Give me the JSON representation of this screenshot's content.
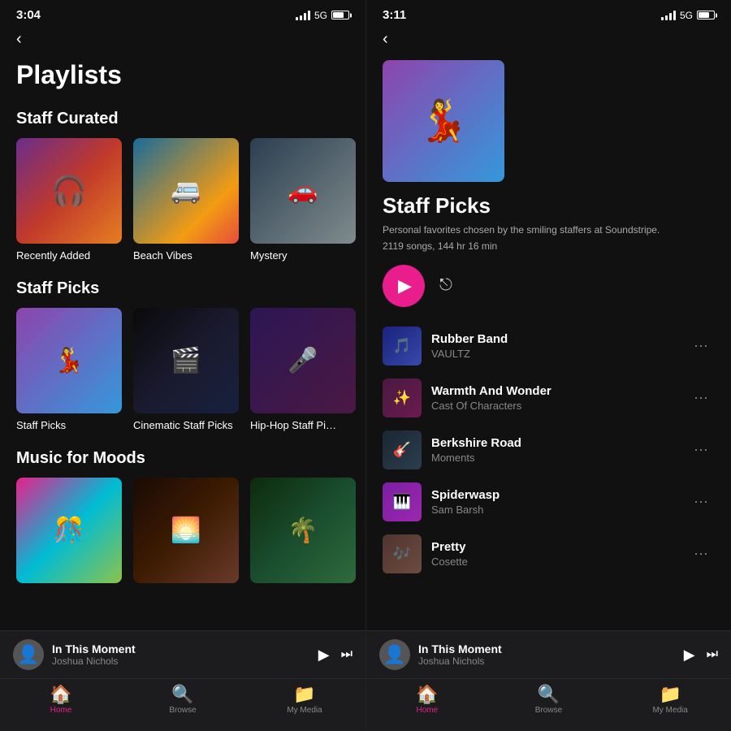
{
  "left": {
    "statusBar": {
      "time": "3:04",
      "signal": "5G"
    },
    "title": "Playlists",
    "sections": [
      {
        "id": "staff-curated",
        "label": "Staff Curated",
        "cards": [
          {
            "id": "recently-added",
            "label": "Recently Added",
            "imgClass": "img-recently-added"
          },
          {
            "id": "beach-vibes",
            "label": "Beach Vibes",
            "imgClass": "img-beach-vibes"
          },
          {
            "id": "mystery",
            "label": "Mystery",
            "imgClass": "img-mystery"
          }
        ]
      },
      {
        "id": "staff-picks",
        "label": "Staff Picks",
        "cards": [
          {
            "id": "staff-picks",
            "label": "Staff Picks",
            "imgClass": "img-staff-picks"
          },
          {
            "id": "cinematic-staff-picks",
            "label": "Cinematic Staff Picks",
            "imgClass": "img-cinematic"
          },
          {
            "id": "hiphop-staff-picks",
            "label": "Hip-Hop Staff Pi…",
            "imgClass": "img-hiphop"
          }
        ]
      },
      {
        "id": "music-for-moods",
        "label": "Music for Moods",
        "cards": [
          {
            "id": "mood1",
            "label": "",
            "imgClass": "img-mood1"
          },
          {
            "id": "mood2",
            "label": "",
            "imgClass": "img-mood2"
          },
          {
            "id": "mood3",
            "label": "",
            "imgClass": "img-mood3"
          }
        ]
      }
    ],
    "nowPlaying": {
      "title": "In This Moment",
      "artist": "Joshua Nichols"
    },
    "tabs": [
      {
        "id": "home",
        "label": "Home",
        "icon": "🏠",
        "active": true
      },
      {
        "id": "browse",
        "label": "Browse",
        "icon": "🔍",
        "active": false
      },
      {
        "id": "my-media",
        "label": "My Media",
        "icon": "📁",
        "active": false
      }
    ]
  },
  "right": {
    "statusBar": {
      "time": "3:11",
      "signal": "5G"
    },
    "playlist": {
      "name": "Staff Picks",
      "description": "Personal favorites chosen by the smiling staffers at Soundstripe.",
      "meta": "2119 songs, 144 hr 16 min"
    },
    "songs": [
      {
        "id": "rubber-band",
        "title": "Rubber Band",
        "artist": "VAULTZ",
        "thumbClass": "song-thumb-1"
      },
      {
        "id": "warmth-and-wonder",
        "title": "Warmth And Wonder",
        "artist": "Cast Of Characters",
        "thumbClass": "song-thumb-2"
      },
      {
        "id": "berkshire-road",
        "title": "Berkshire Road",
        "artist": "Moments",
        "thumbClass": "song-thumb-3"
      },
      {
        "id": "spiderwasp",
        "title": "Spiderwasp",
        "artist": "Sam Barsh",
        "thumbClass": "song-thumb-4"
      },
      {
        "id": "pretty",
        "title": "Pretty",
        "artist": "Cosette",
        "thumbClass": "song-thumb-5"
      }
    ],
    "nowPlaying": {
      "title": "In This Moment",
      "artist": "Joshua Nichols"
    },
    "tabs": [
      {
        "id": "home",
        "label": "Home",
        "icon": "🏠",
        "active": true
      },
      {
        "id": "browse",
        "label": "Browse",
        "icon": "🔍",
        "active": false
      },
      {
        "id": "my-media",
        "label": "My Media",
        "icon": "📁",
        "active": false
      }
    ]
  }
}
